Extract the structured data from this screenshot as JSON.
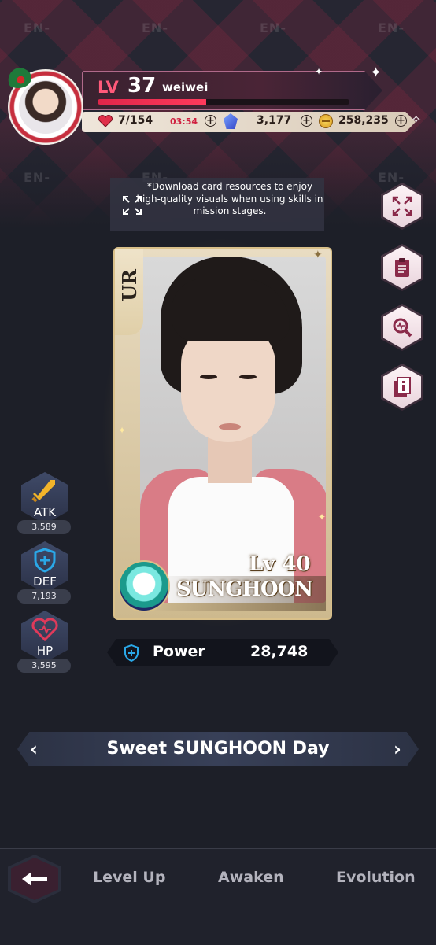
{
  "header": {
    "level_label": "LV",
    "level": "37",
    "username": "weiwei",
    "xp_progress": 0.43,
    "hearts": "7/154",
    "heart_timer": "03:54",
    "gems": "3,177",
    "coins": "258,235"
  },
  "notice": {
    "text": "*Download card resources to enjoy high-quality visuals when using skills in mission stages."
  },
  "card": {
    "rarity": "UR",
    "level": "Lv 40",
    "name": "SUNGHOON"
  },
  "stats": {
    "atk_label": "ATK",
    "atk_value": "3,589",
    "def_label": "DEF",
    "def_value": "7,193",
    "hp_label": "HP",
    "hp_value": "3,595"
  },
  "power": {
    "label": "Power",
    "value": "28,748"
  },
  "card_title": "Sweet SUNGHOON Day",
  "nav": {
    "level_up": "Level Up",
    "awaken": "Awaken",
    "evolution": "Evolution"
  },
  "brand_mark": "EN-",
  "colors": {
    "accent": "#ff5a7a",
    "background": "#1d1f28",
    "gold": "#d9c08a"
  }
}
